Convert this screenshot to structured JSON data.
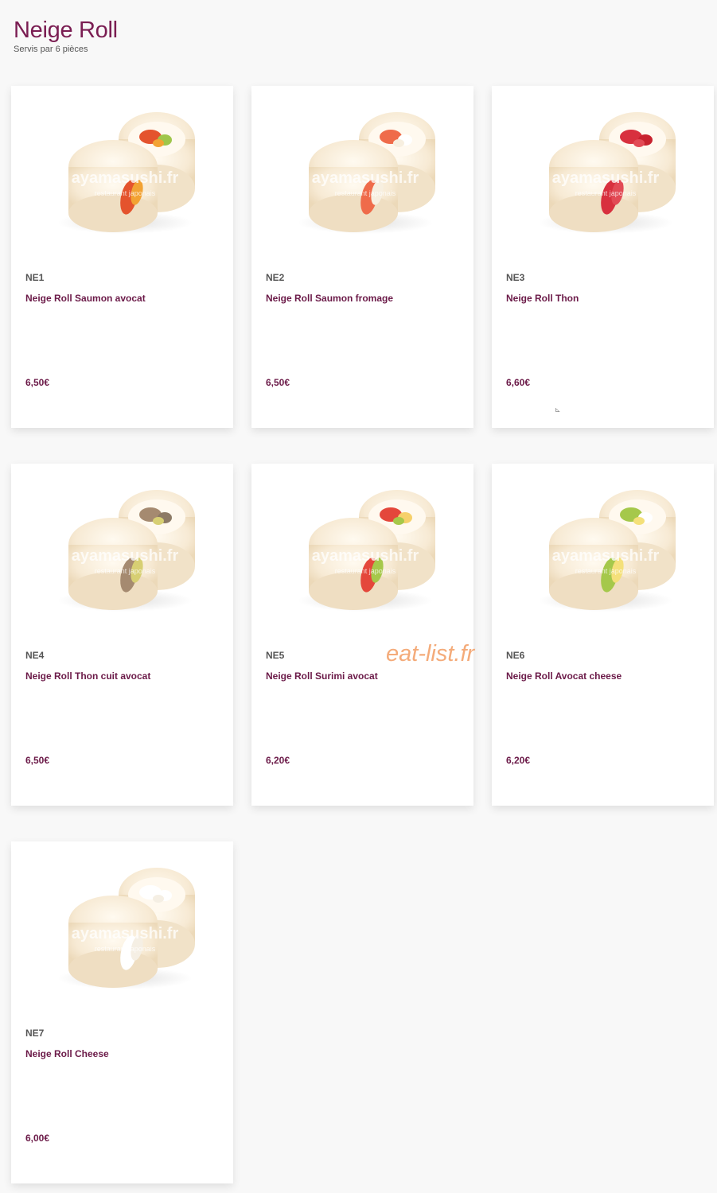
{
  "section": {
    "title": "Neige Roll",
    "subtitle": "Servis par 6 pièces"
  },
  "items": [
    {
      "code": "NE1",
      "name": "Neige Roll Saumon avocat",
      "price": "6,50€",
      "image_watermark": "ayamasushi.fr",
      "image_watermark_sub": "restaurant japonais",
      "fillings": [
        "#e4532d",
        "#f2a233",
        "#9fc64a"
      ]
    },
    {
      "code": "NE2",
      "name": "Neige Roll Saumon fromage",
      "price": "6,50€",
      "image_watermark": "ayamasushi.fr",
      "image_watermark_sub": "restaurant japonais",
      "fillings": [
        "#ef6b4a",
        "#f7efe0",
        "#ffffff"
      ]
    },
    {
      "code": "NE3",
      "name": "Neige Roll Thon",
      "price": "6,60€",
      "image_watermark": "ayamasushi.fr",
      "image_watermark_sub": "restaurant japonais",
      "fillings": [
        "#d8303e",
        "#e24a55",
        "#c8232f"
      ]
    },
    {
      "code": "NE4",
      "name": "Neige Roll Thon cuit avocat",
      "price": "6,50€",
      "image_watermark": "ayamasushi.fr",
      "image_watermark_sub": "restaurant japonais",
      "fillings": [
        "#a58a70",
        "#d7cf73",
        "#8c7a66"
      ]
    },
    {
      "code": "NE5",
      "name": "Neige Roll Surimi avocat",
      "price": "6,20€",
      "image_watermark": "ayamasushi.fr",
      "image_watermark_sub": "restaurant japonais",
      "fillings": [
        "#e4473b",
        "#a6c84a",
        "#f6d06a"
      ]
    },
    {
      "code": "NE6",
      "name": "Neige Roll Avocat cheese",
      "price": "6,20€",
      "image_watermark": "ayamasushi.fr",
      "image_watermark_sub": "restaurant japonais",
      "fillings": [
        "#a5c84b",
        "#f4e07a",
        "#ffffff"
      ]
    },
    {
      "code": "NE7",
      "name": "Neige Roll Cheese",
      "price": "6,00€",
      "image_watermark": "ayamasushi.fr",
      "image_watermark_sub": "restaurant japonais",
      "fillings": [
        "#ffffff",
        "#f5efe4",
        "#ffffff"
      ]
    }
  ],
  "overlay_watermark": "eat-list.fr",
  "colors": {
    "accent": "#7a1d52",
    "background": "#f8f8f8",
    "card": "#ffffff",
    "watermark": "#f3a36c"
  }
}
